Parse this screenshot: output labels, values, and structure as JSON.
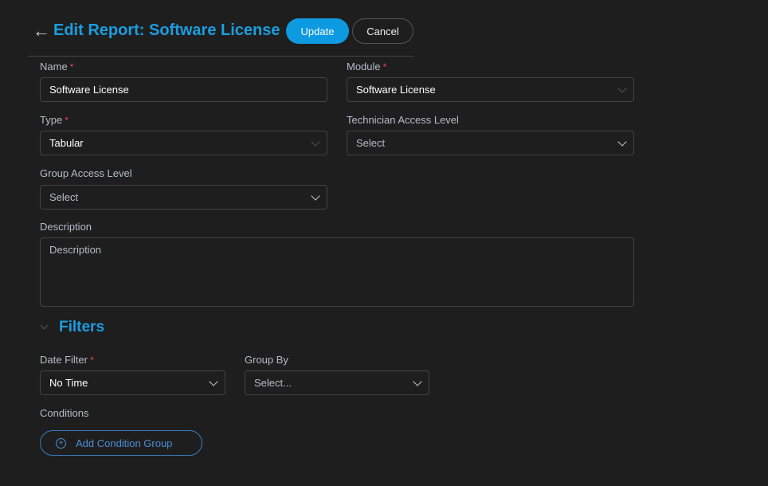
{
  "header": {
    "back_icon": "arrow-left-icon",
    "title": "Edit Report: Software License",
    "update_label": "Update",
    "cancel_label": "Cancel"
  },
  "form": {
    "name": {
      "label": "Name",
      "required": "*",
      "value": "Software License"
    },
    "module": {
      "label": "Module",
      "required": "*",
      "value": "Software License"
    },
    "type": {
      "label": "Type",
      "required": "*",
      "value": "Tabular"
    },
    "technician_access": {
      "label": "Technician Access Level",
      "value": "Select"
    },
    "group_access": {
      "label": "Group Access Level",
      "value": "Select"
    },
    "description": {
      "label": "Description",
      "placeholder": "Description"
    }
  },
  "filters": {
    "title": "Filters",
    "date_filter": {
      "label": "Date Filter",
      "required": "*",
      "value": "No Time"
    },
    "group_by": {
      "label": "Group By",
      "value": "Select..."
    },
    "conditions_label": "Conditions",
    "add_condition_label": "Add Condition Group"
  }
}
